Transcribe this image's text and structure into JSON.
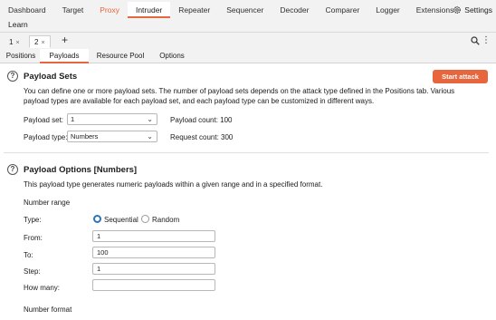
{
  "main_tabs": [
    "Dashboard",
    "Target",
    "Proxy",
    "Intruder",
    "Repeater",
    "Sequencer",
    "Decoder",
    "Comparer",
    "Logger",
    "Extensions"
  ],
  "settings_label": "Settings",
  "learn_label": "Learn",
  "attack_tabs": [
    {
      "label": "1"
    },
    {
      "label": "2"
    }
  ],
  "close_glyph": "×",
  "add_glyph": "+",
  "sub_tabs": [
    "Positions",
    "Payloads",
    "Resource Pool",
    "Options"
  ],
  "payload_sets": {
    "title": "Payload Sets",
    "start_attack": "Start attack",
    "desc1": "You can define one or more payload sets. The number of payload sets depends on the attack type defined in the Positions tab. Various",
    "desc2": "payload types are available for each payload set, and each payload type can be customized in different ways.",
    "set_label": "Payload set:",
    "set_value": "1",
    "count_label": "Payload count: 100",
    "type_label": "Payload type:",
    "type_value": "Numbers",
    "request_label": "Request count: 300"
  },
  "payload_options": {
    "title": "Payload Options [Numbers]",
    "desc": "This payload type generates numeric payloads within a given range and in a specified format.",
    "range_heading": "Number range",
    "type_label": "Type:",
    "sequential": "Sequential",
    "random": "Random",
    "from_label": "From:",
    "from_value": "1",
    "to_label": "To:",
    "to_value": "100",
    "step_label": "Step:",
    "step_value": "1",
    "howmany_label": "How many:",
    "howmany_value": "",
    "format_heading": "Number format"
  },
  "colors": {
    "accent": "#e8663d",
    "radio_selected": "#2e74b5"
  }
}
